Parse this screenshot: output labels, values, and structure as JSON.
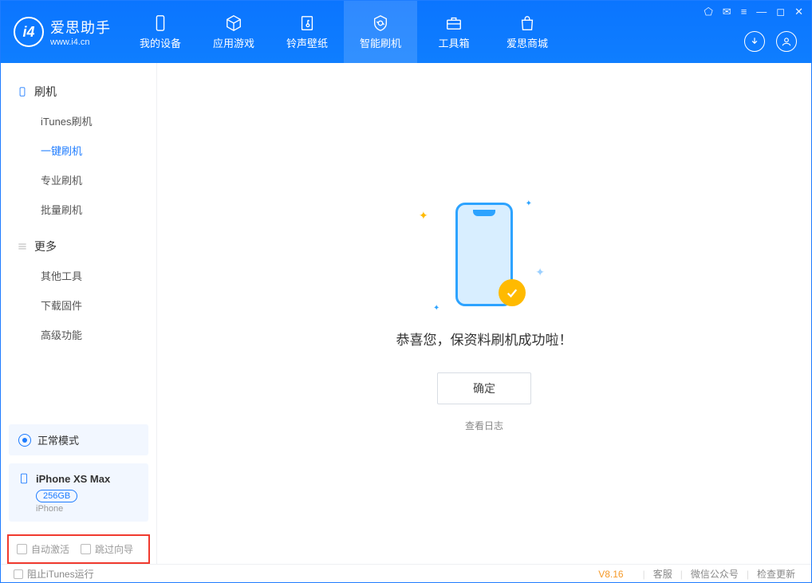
{
  "logo": {
    "name": "爱思助手",
    "url": "www.i4.cn"
  },
  "nav": {
    "items": [
      {
        "label": "我的设备"
      },
      {
        "label": "应用游戏"
      },
      {
        "label": "铃声壁纸"
      },
      {
        "label": "智能刷机"
      },
      {
        "label": "工具箱"
      },
      {
        "label": "爱思商城"
      }
    ]
  },
  "sidebar": {
    "section1": {
      "title": "刷机",
      "items": [
        "iTunes刷机",
        "一键刷机",
        "专业刷机",
        "批量刷机"
      ]
    },
    "section2": {
      "title": "更多",
      "items": [
        "其他工具",
        "下载固件",
        "高级功能"
      ]
    },
    "status": "正常模式",
    "device": {
      "name": "iPhone XS Max",
      "capacity": "256GB",
      "type": "iPhone"
    },
    "checks": {
      "auto_activate": "自动激活",
      "skip_guide": "跳过向导"
    }
  },
  "main": {
    "message": "恭喜您，保资料刷机成功啦！",
    "ok": "确定",
    "log": "查看日志"
  },
  "footer": {
    "block_itunes": "阻止iTunes运行",
    "version": "V8.16",
    "links": [
      "客服",
      "微信公众号",
      "检查更新"
    ]
  }
}
